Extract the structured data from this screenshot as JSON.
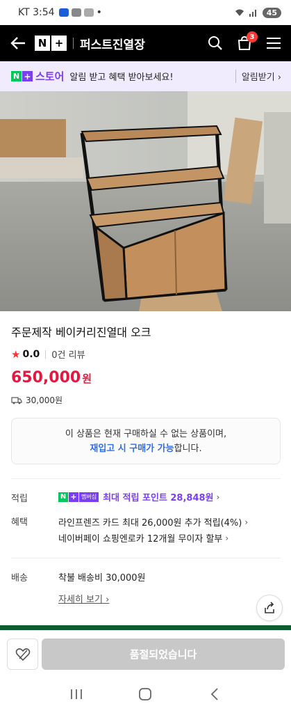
{
  "status_bar": {
    "carrier": "KT",
    "time": "3:54",
    "dot": "•",
    "battery": "45"
  },
  "header": {
    "logo_n": "N",
    "logo_plus": "+",
    "store_name": "퍼스트진열장",
    "cart_count": "3"
  },
  "banner": {
    "n": "N",
    "plus": "+",
    "store_label": "스토어",
    "message": "알림 받고 혜택 받아보세요!",
    "action": "알림받기 ›"
  },
  "product": {
    "title": "주문제작 베이커리진열대 오크",
    "rating": "0.0",
    "review_count": "0건 리뷰",
    "price": "650,000",
    "price_unit": "원",
    "shipping_fee": "30,000원"
  },
  "notice": {
    "line1": "이 상품은 현재 구매하실 수 없는 상품이며,",
    "line2_highlight": "재입고 시 구매가 가능",
    "line2_rest": "합니다."
  },
  "details": {
    "points_label": "적립",
    "membership_badge": "멤버십",
    "points_text": "최대 적립 포인트 28,848원",
    "benefit_label": "혜택",
    "benefit_1": "라인프렌즈 카드 최대 26,000원 추가 적립(4%)",
    "benefit_2": "네이버페이 쇼핑엔로카 12개월 무이자 할부",
    "shipping_label": "배송",
    "shipping_text": "착불 배송비 30,000원",
    "more_link": "자세히 보기"
  },
  "bottom": {
    "soldout_label": "품절되었습니다"
  },
  "colors": {
    "naver_green": "#03c75a",
    "plus_purple": "#7b3ff2",
    "price_red": "#e21a40",
    "link_blue": "#2f6ee8"
  }
}
